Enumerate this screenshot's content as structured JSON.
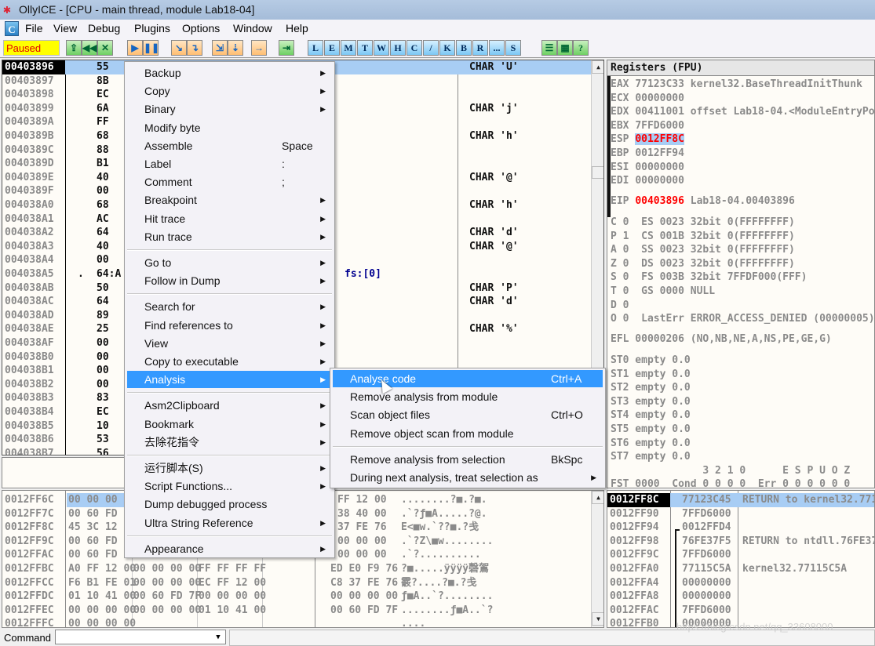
{
  "window": {
    "title": "OllyICE - [CPU - main thread, module Lab18-04]",
    "status": "Paused"
  },
  "menu": [
    "File",
    "View",
    "Debug",
    "Plugins",
    "Options",
    "Window",
    "Help"
  ],
  "toolbar": {
    "buttons": [
      {
        "name": "open-icon",
        "label": "⇪",
        "style": "g"
      },
      {
        "name": "restart-icon",
        "label": "◀◀",
        "style": "g"
      },
      {
        "name": "close-icon",
        "label": "✕",
        "style": "g"
      },
      {
        "name": "run-icon",
        "label": "▶",
        "style": "o"
      },
      {
        "name": "pause-icon",
        "label": "❚❚",
        "style": "o"
      },
      {
        "name": "step-into-icon",
        "label": "↘",
        "style": "o"
      },
      {
        "name": "step-over-icon",
        "label": "↴",
        "style": "o"
      },
      {
        "name": "trace-into-icon",
        "label": "⇲",
        "style": "o"
      },
      {
        "name": "trace-over-icon",
        "label": "⇣",
        "style": "o"
      },
      {
        "name": "execute-till-return-icon",
        "label": "→",
        "style": "o"
      },
      {
        "name": "go-to-origin-icon",
        "label": "⇥",
        "style": "g"
      },
      {
        "name": "log-window-button",
        "label": "L",
        "style": "b"
      },
      {
        "name": "modules-window-button",
        "label": "E",
        "style": "b"
      },
      {
        "name": "memory-window-button",
        "label": "M",
        "style": "b"
      },
      {
        "name": "threads-window-button",
        "label": "T",
        "style": "b"
      },
      {
        "name": "windows-window-button",
        "label": "W",
        "style": "b"
      },
      {
        "name": "handles-window-button",
        "label": "H",
        "style": "b"
      },
      {
        "name": "cpu-window-button",
        "label": "C",
        "style": "b"
      },
      {
        "name": "patches-window-button",
        "label": "/",
        "style": "b"
      },
      {
        "name": "call-stack-button",
        "label": "K",
        "style": "b"
      },
      {
        "name": "breakpoints-window-button",
        "label": "B",
        "style": "b"
      },
      {
        "name": "references-window-button",
        "label": "R",
        "style": "b"
      },
      {
        "name": "run-trace-button",
        "label": "...",
        "style": "b"
      },
      {
        "name": "source-window-button",
        "label": "S",
        "style": "b"
      },
      {
        "name": "list-icon",
        "label": "☰",
        "style": "g"
      },
      {
        "name": "colors-icon",
        "label": "▦",
        "style": "g"
      },
      {
        "name": "help-icon",
        "label": "?",
        "style": "g"
      }
    ]
  },
  "disasm": {
    "rows": [
      {
        "addr": "00403896",
        "hex": "55",
        "comment": "CHAR 'U'"
      },
      {
        "addr": "00403897",
        "hex": "8B",
        "comment": ""
      },
      {
        "addr": "00403898",
        "hex": "EC",
        "comment": ""
      },
      {
        "addr": "00403899",
        "hex": "6A",
        "comment": "CHAR 'j'"
      },
      {
        "addr": "0040389A",
        "hex": "FF",
        "comment": ""
      },
      {
        "addr": "0040389B",
        "hex": "68",
        "comment": "CHAR 'h'"
      },
      {
        "addr": "0040389C",
        "hex": "88",
        "comment": ""
      },
      {
        "addr": "0040389D",
        "hex": "B1",
        "comment": ""
      },
      {
        "addr": "0040389E",
        "hex": "40",
        "comment": "CHAR '@'"
      },
      {
        "addr": "0040389F",
        "hex": "00",
        "comment": ""
      },
      {
        "addr": "004038A0",
        "hex": "68",
        "comment": "CHAR 'h'"
      },
      {
        "addr": "004038A1",
        "hex": "AC",
        "comment": ""
      },
      {
        "addr": "004038A2",
        "hex": "64",
        "comment": "CHAR 'd'"
      },
      {
        "addr": "004038A3",
        "hex": "40",
        "comment": "CHAR '@'"
      },
      {
        "addr": "004038A4",
        "hex": "00",
        "comment": ""
      },
      {
        "addr": "004038A5",
        "hex": "64:A",
        "mark": ".",
        "disasm": "fs:[0]",
        "comment": ""
      },
      {
        "addr": "004038AB",
        "hex": "50",
        "comment": "CHAR 'P'"
      },
      {
        "addr": "004038AC",
        "hex": "64",
        "comment": "CHAR 'd'"
      },
      {
        "addr": "004038AD",
        "hex": "89",
        "comment": ""
      },
      {
        "addr": "004038AE",
        "hex": "25",
        "comment": "CHAR '%'"
      },
      {
        "addr": "004038AF",
        "hex": "00",
        "comment": ""
      },
      {
        "addr": "004038B0",
        "hex": "00",
        "comment": ""
      },
      {
        "addr": "004038B1",
        "hex": "00",
        "comment": ""
      },
      {
        "addr": "004038B2",
        "hex": "00",
        "comment": ""
      },
      {
        "addr": "004038B3",
        "hex": "83",
        "comment": ""
      },
      {
        "addr": "004038B4",
        "hex": "EC",
        "comment": ""
      },
      {
        "addr": "004038B5",
        "hex": "10",
        "comment": ""
      },
      {
        "addr": "004038B6",
        "hex": "53",
        "comment": ""
      },
      {
        "addr": "004038B7",
        "hex": "56",
        "comment": ""
      }
    ]
  },
  "context_menu": {
    "items": [
      {
        "label": "Backup",
        "sub": true
      },
      {
        "label": "Copy",
        "sub": true
      },
      {
        "label": "Binary",
        "sub": true
      },
      {
        "label": "Modify byte"
      },
      {
        "label": "Assemble",
        "shortcut": "Space"
      },
      {
        "label": "Label",
        "shortcut": ":"
      },
      {
        "label": "Comment",
        "shortcut": ";"
      },
      {
        "label": "Breakpoint",
        "sub": true
      },
      {
        "label": "Hit trace",
        "sub": true
      },
      {
        "label": "Run trace",
        "sub": true
      },
      {
        "sep": true
      },
      {
        "label": "Go to",
        "sub": true
      },
      {
        "label": "Follow in Dump",
        "sub": true
      },
      {
        "sep": true
      },
      {
        "label": "Search for",
        "sub": true
      },
      {
        "label": "Find references to",
        "sub": true
      },
      {
        "label": "View",
        "sub": true
      },
      {
        "label": "Copy to executable",
        "sub": true
      },
      {
        "label": "Analysis",
        "sub": true,
        "highlight": true
      },
      {
        "sep": true
      },
      {
        "label": "Asm2Clipboard",
        "sub": true
      },
      {
        "label": "Bookmark",
        "sub": true
      },
      {
        "label": "去除花指令",
        "sub": true
      },
      {
        "sep": true
      },
      {
        "label": "运行脚本(S)",
        "sub": true
      },
      {
        "label": "Script Functions...",
        "sub": true
      },
      {
        "label": "Dump debugged process"
      },
      {
        "label": "Ultra String Reference",
        "sub": true
      },
      {
        "sep": true
      },
      {
        "label": "Appearance",
        "sub": true
      }
    ]
  },
  "analysis_submenu": {
    "items": [
      {
        "label": "Analyse code",
        "shortcut": "Ctrl+A",
        "highlight": true
      },
      {
        "label": "Remove analysis from module"
      },
      {
        "label": "Scan object files",
        "shortcut": "Ctrl+O"
      },
      {
        "label": "Remove object scan from module"
      },
      {
        "sep": true
      },
      {
        "label": "Remove analysis from selection",
        "shortcut": "BkSpc"
      },
      {
        "label": "During next analysis, treat selection as",
        "sub": true
      }
    ]
  },
  "registers": {
    "title": "Registers (FPU)",
    "general": [
      {
        "name": "EAX",
        "value": "77123C33",
        "comment": "kernel32.BaseThreadInitThunk"
      },
      {
        "name": "ECX",
        "value": "00000000",
        "comment": ""
      },
      {
        "name": "EDX",
        "value": "00411001",
        "comment": "offset Lab18-04.<ModuleEntryPoint>"
      },
      {
        "name": "EBX",
        "value": "7FFD6000",
        "comment": ""
      },
      {
        "name": "ESP",
        "value": "0012FF8C",
        "comment": "",
        "changed": true,
        "selected": true
      },
      {
        "name": "EBP",
        "value": "0012FF94",
        "comment": ""
      },
      {
        "name": "ESI",
        "value": "00000000",
        "comment": ""
      },
      {
        "name": "EDI",
        "value": "00000000",
        "comment": ""
      }
    ],
    "eip": {
      "name": "EIP",
      "value": "00403896",
      "comment": "Lab18-04.00403896"
    },
    "flags": [
      "C 0  ES 0023 32bit 0(FFFFFFFF)",
      "P 1  CS 001B 32bit 0(FFFFFFFF)",
      "A 0  SS 0023 32bit 0(FFFFFFFF)",
      "Z 0  DS 0023 32bit 0(FFFFFFFF)",
      "S 0  FS 003B 32bit 7FFDF000(FFF)",
      "T 0  GS 0000 NULL",
      "D 0",
      "O 0  LastErr ERROR_ACCESS_DENIED (00000005)"
    ],
    "efl": "EFL 00000206 (NO,NB,NE,A,NS,PE,GE,G)",
    "fpu": [
      "ST0 empty 0.0",
      "ST1 empty 0.0",
      "ST2 empty 0.0",
      "ST3 empty 0.0",
      "ST4 empty 0.0",
      "ST5 empty 0.0",
      "ST6 empty 0.0",
      "ST7 empty 0.0"
    ],
    "fpu_header": "               3 2 1 0      E S P U O Z",
    "fst": "FST 0000  Cond 0 0 0 0  Err 0 0 0 0 0 0"
  },
  "dump": {
    "rows": [
      {
        "addr": "0012FF6C",
        "g1": "00 00 00",
        "g4": "FF 12 00",
        "ascii": "........?■.?■."
      },
      {
        "addr": "0012FF7C",
        "g1": "00 60 FD",
        "g4": "38 40 00",
        "ascii": ".`?ƒ■A.....?@."
      },
      {
        "addr": "0012FF8C",
        "g1": "45 3C 12",
        "g4": "37 FE 76",
        "ascii": "E<■w.`??■.?戋"
      },
      {
        "addr": "0012FF9C",
        "g1": "00 60 FD",
        "g4": "00 00 00",
        "ascii": ".`?Z\\■w........"
      },
      {
        "addr": "0012FFAC",
        "g1": "00 60 FD",
        "g4": "00 00 00",
        "ascii": ".`?.........."
      },
      {
        "addr": "0012FFBC",
        "g1": "A0 FF 12 00",
        "g2": "00 00 00 00",
        "g3": "FF FF FF FF",
        "g4": "ED E0 F9 76",
        "ascii": "?■.....ÿÿÿÿ磬鴐"
      },
      {
        "addr": "0012FFCC",
        "g1": "F6 B1 FE 01",
        "g2": "00 00 00 00",
        "g3": "EC FF 12 00",
        "g4": "C8 37 FE 76",
        "ascii": "霰?....?■.?戋"
      },
      {
        "addr": "0012FFDC",
        "g1": "01 10 41 00",
        "g2": "00 60 FD 7F",
        "g3": "00 00 00 00",
        "g4": "00 00 00 00",
        "ascii": "ƒ■A..`?........"
      },
      {
        "addr": "0012FFEC",
        "g1": "00 00 00 00",
        "g2": "00 00 00 00",
        "g3": "01 10 41 00",
        "g4": "00 60 FD 7F",
        "ascii": "........ƒ■A..`?"
      },
      {
        "addr": "0012FFFC",
        "g1": "00 00 00 00",
        "ascii": "...."
      }
    ]
  },
  "stack": {
    "rows": [
      {
        "addr": "0012FF8C",
        "value": "77123C45",
        "comment": "RETURN to kernel32.77123C45"
      },
      {
        "addr": "0012FF90",
        "value": "7FFD6000",
        "comment": ""
      },
      {
        "addr": "0012FF94",
        "value": "0012FFD4",
        "comment": ""
      },
      {
        "addr": "0012FF98",
        "value": "76FE37F5",
        "comment": "RETURN to ntdll.76FE37F5"
      },
      {
        "addr": "0012FF9C",
        "value": "7FFD6000",
        "comment": ""
      },
      {
        "addr": "0012FFA0",
        "value": "77115C5A",
        "comment": "kernel32.77115C5A"
      },
      {
        "addr": "0012FFA4",
        "value": "00000000",
        "comment": ""
      },
      {
        "addr": "0012FFA8",
        "value": "00000000",
        "comment": ""
      },
      {
        "addr": "0012FFAC",
        "value": "7FFD6000",
        "comment": ""
      },
      {
        "addr": "0012FFB0",
        "value": "00000000",
        "comment": ""
      }
    ]
  },
  "command_bar": {
    "label": "Command",
    "value": ""
  },
  "watermark": "https://blog.csdn.net/qq_33608000",
  "colors": {
    "selection": "#a8cdf4",
    "menu_highlight": "#3399ff",
    "changed_register": "#ff0000",
    "status_bg": "#ffff00"
  }
}
